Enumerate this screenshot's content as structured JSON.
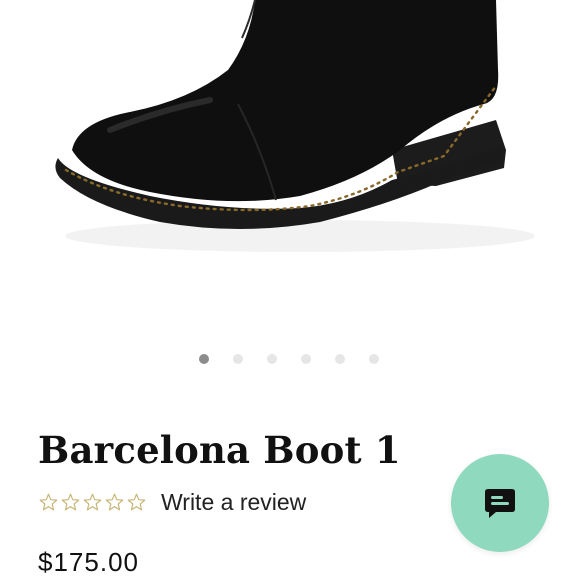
{
  "product": {
    "image_alt": "black suede ankle boot with studded welt",
    "title": "Barcelona Boot 1",
    "price": "$175.00",
    "rating": {
      "stars_total": 5,
      "stars_filled": 0,
      "review_label": "Write a review"
    }
  },
  "carousel": {
    "slide_count": 6,
    "active_index": 0
  },
  "chat": {
    "icon": "chat-bubble-icon"
  },
  "colors": {
    "star_outline": "#c9b77a",
    "chat_bg": "#8fd9bf",
    "dot_active": "#8c8c8c",
    "dot_inactive": "#e6e6e6"
  }
}
